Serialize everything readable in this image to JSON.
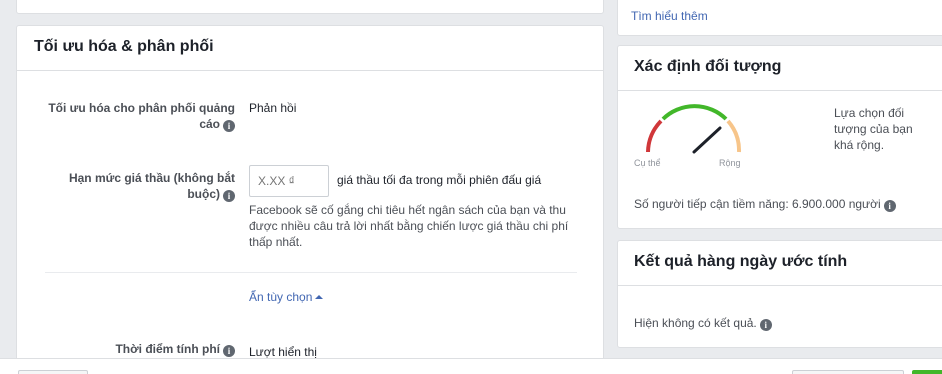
{
  "main": {
    "title": "Tối ưu hóa & phân phối",
    "optimization_label": "Tối ưu hóa cho phân phối quảng cáo",
    "optimization_value": "Phản hồi",
    "bid_label": "Hạn mức giá thầu (không bắt buộc)",
    "bid_placeholder": "X.XX ₫",
    "bid_suffix": "giá thầu tối đa trong mỗi phiên đấu giá",
    "bid_help": "Facebook sẽ cố gắng chi tiêu hết ngân sách của bạn và thu được nhiều câu trả lời nhất bằng chiến lược giá thầu chi phí thấp nhất.",
    "hide_options": "Ẩn tùy chọn",
    "charge_label": "Thời điểm tính phí",
    "charge_value": "Lượt hiển thị"
  },
  "sidebar": {
    "learn_more": "Tìm hiểu thêm",
    "audience": {
      "title": "Xác định đối tượng",
      "gauge_left": "Cụ thể",
      "gauge_right": "Rộng",
      "gauge_level": 0.8,
      "description": "Lựa chọn đối tượng của bạn khá rộng.",
      "reach": "Số người tiếp cận tiềm năng: 6.900.000 người"
    },
    "results": {
      "title": "Kết quả hàng ngày ước tính",
      "text": "Hiện không có kết quả."
    }
  },
  "colors": {
    "link": "#4267b2",
    "gauge_red": "#d0373a",
    "gauge_green": "#42b72a",
    "gauge_orange": "#f7c58a"
  }
}
